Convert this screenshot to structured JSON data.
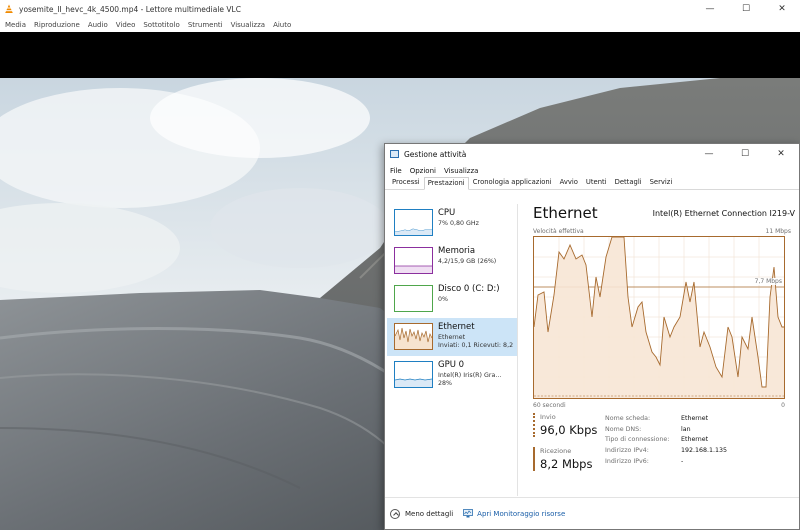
{
  "vlc": {
    "title": "yosemite_II_hevc_4k_4500.mp4 - Lettore multimediale VLC",
    "menu": [
      "Media",
      "Riproduzione",
      "Audio",
      "Video",
      "Sottotitolo",
      "Strumenti",
      "Visualizza",
      "Aiuto"
    ],
    "controls": {
      "minimize": "—",
      "maximize": "☐",
      "close": "✕"
    }
  },
  "taskmgr": {
    "title": "Gestione attività",
    "controls": {
      "minimize": "—",
      "maximize": "☐",
      "close": "✕"
    },
    "menu": [
      "File",
      "Opzioni",
      "Visualizza"
    ],
    "tabs": [
      "Processi",
      "Prestazioni",
      "Cronologia applicazioni",
      "Avvio",
      "Utenti",
      "Dettagli",
      "Servizi"
    ],
    "active_tab": "Prestazioni",
    "sidebar": [
      {
        "name": "CPU",
        "sub": "7% 0,80 GHz",
        "sub2": "",
        "color": "#1f7fc2"
      },
      {
        "name": "Memoria",
        "sub": "4,2/15,9 GB (26%)",
        "sub2": "",
        "color": "#8b2f9e"
      },
      {
        "name": "Disco 0 (C: D:)",
        "sub": "0%",
        "sub2": "",
        "color": "#4fa64b"
      },
      {
        "name": "Ethernet",
        "sub": "Ethernet",
        "sub2": "Inviati: 0,1 Ricevuti: 8,2",
        "color": "#a76a2e"
      },
      {
        "name": "GPU 0",
        "sub": "Intel(R) Iris(R) Gra...",
        "sub2": "28%",
        "color": "#1f7fc2"
      }
    ],
    "main": {
      "title": "Ethernet",
      "adapter": "Intel(R) Ethernet Connection I219-V",
      "graph_label": "Velocità effettiva",
      "graph_max": "11 Mbps",
      "graph_ref": "7,7 Mbps",
      "graph_left_time": "60 secondi",
      "graph_right_time": "0",
      "send_label": "Invio",
      "send_value": "96,0 Kbps",
      "recv_label": "Ricezione",
      "recv_value": "8,2 Mbps",
      "properties": [
        {
          "key": "Nome scheda:",
          "value": "Ethernet"
        },
        {
          "key": "Nome DNS:",
          "value": "lan"
        },
        {
          "key": "Tipo di connessione:",
          "value": "Ethernet"
        },
        {
          "key": "Indirizzo IPv4:",
          "value": "192.168.1.135"
        },
        {
          "key": "Indirizzo IPv6:",
          "value": "-"
        }
      ]
    },
    "footer": {
      "less_details": "Meno dettagli",
      "resource_monitor": "Apri Monitoraggio risorse"
    },
    "accent_color": "#a76a2e"
  }
}
